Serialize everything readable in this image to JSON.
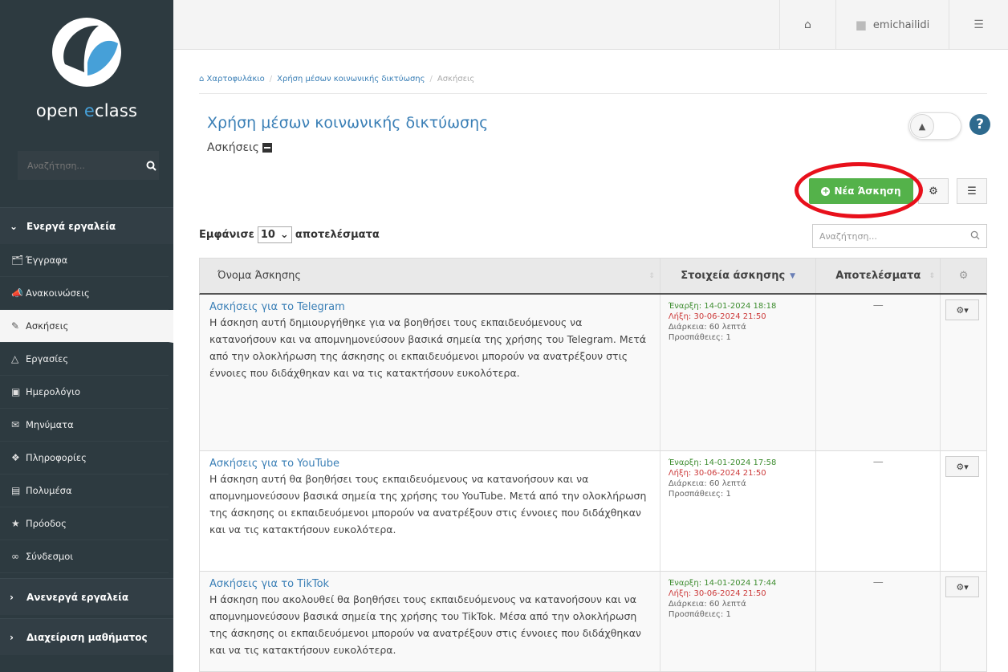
{
  "sidebar": {
    "logo_text_pre": "open ",
    "logo_text_e": "e",
    "logo_text_post": "class",
    "search_placeholder": "Αναζήτηση...",
    "active_tools_label": "Ενεργά εργαλεία",
    "items": [
      {
        "label": "Έγγραφα",
        "icon": "folder-icon"
      },
      {
        "label": "Ανακοινώσεις",
        "icon": "bullhorn-icon"
      },
      {
        "label": "Ασκήσεις",
        "icon": "edit-icon"
      },
      {
        "label": "Εργασίες",
        "icon": "flask-icon"
      },
      {
        "label": "Ημερολόγιο",
        "icon": "calendar-icon"
      },
      {
        "label": "Μηνύματα",
        "icon": "envelope-icon"
      },
      {
        "label": "Πληροφορίες",
        "icon": "info-icon"
      },
      {
        "label": "Πολυμέσα",
        "icon": "film-icon"
      },
      {
        "label": "Πρόοδος",
        "icon": "trophy-icon"
      },
      {
        "label": "Σύνδεσμοι",
        "icon": "link-icon"
      }
    ],
    "inactive_tools_label": "Ανενεργά εργαλεία",
    "course_admin_label": "Διαχείριση μαθήματος"
  },
  "topbar": {
    "username": "emichailidi"
  },
  "breadcrumb": {
    "home": "Χαρτοφυλάκιο",
    "course": "Χρήση μέσων κοινωνικής δικτύωσης",
    "current": "Ασκήσεις"
  },
  "page": {
    "course_title": "Χρήση μέσων κοινωνικής δικτύωσης",
    "section_title": "Ασκήσεις",
    "new_exercise_label": "Νέα Άσκηση"
  },
  "table_controls": {
    "show_label": "Εμφάνισε",
    "page_size": "10",
    "results_label": "αποτελέσματα",
    "search_placeholder": "Αναζήτηση..."
  },
  "table": {
    "headers": [
      "Όνομα Άσκησης",
      "Στοιχεία άσκησης",
      "Αποτελέσματα"
    ],
    "rows": [
      {
        "title": "Ασκήσεις για το Telegram",
        "description": "Η άσκηση αυτή δημιουργήθηκε για να βοηθήσει τους εκπαιδευόμενους να κατανοήσουν και να απομνημονεύσουν βασικά σημεία της χρήσης του Telegram. Μετά από την ολοκλήρωση της άσκησης οι εκπαιδευόμενοι μπορούν να ανατρέξουν στις έννοιες που διδάχθηκαν και να τις κατακτήσουν ευκολότερα.",
        "start": "Έναρξη: 14-01-2024 18:18",
        "end": "Λήξη: 30-06-2024 21:50",
        "duration": "Διάρκεια: 60 λεπτά",
        "attempts": "Προσπάθειες: 1",
        "results": "—"
      },
      {
        "title": "Ασκήσεις για το YouTube",
        "description": "Η άσκηση αυτή θα βοηθήσει τους εκπαιδευόμενους να κατανοήσουν και να απομνημονεύσουν βασικά σημεία της χρήσης του YouTube. Μετά από την ολοκλήρωση της άσκησης οι εκπαιδευόμενοι μπορούν να ανατρέξουν στις έννοιες που διδάχθηκαν και να τις κατακτήσουν ευκολότερα.",
        "start": "Έναρξη: 14-01-2024 17:58",
        "end": "Λήξη: 30-06-2024 21:50",
        "duration": "Διάρκεια: 60 λεπτά",
        "attempts": "Προσπάθειες: 1",
        "results": "—"
      },
      {
        "title": "Ασκήσεις για το TikTok",
        "description": "Η άσκηση που ακολουθεί θα βοηθήσει τους εκπαιδευόμενους να κατανοήσουν και να απομνημονεύσουν βασικά σημεία της χρήσης του TikTok. Μέσα από την ολοκλήρωση της άσκησης οι εκπαιδευόμενοι μπορούν να ανατρέξουν στις έννοιες που διδάχθηκαν και να τις κατακτήσουν ευκολότερα.",
        "start": "Έναρξη: 14-01-2024 17:44",
        "end": "Λήξη: 30-06-2024 21:50",
        "duration": "Διάρκεια: 60 λεπτά",
        "attempts": "Προσπάθειες: 1",
        "results": "—"
      }
    ]
  },
  "colors": {
    "sidebar_bg": "#2d3a40",
    "link_blue": "#3a7fb6",
    "new_button_green": "#54b24a",
    "highlight_red": "#e8101b"
  }
}
